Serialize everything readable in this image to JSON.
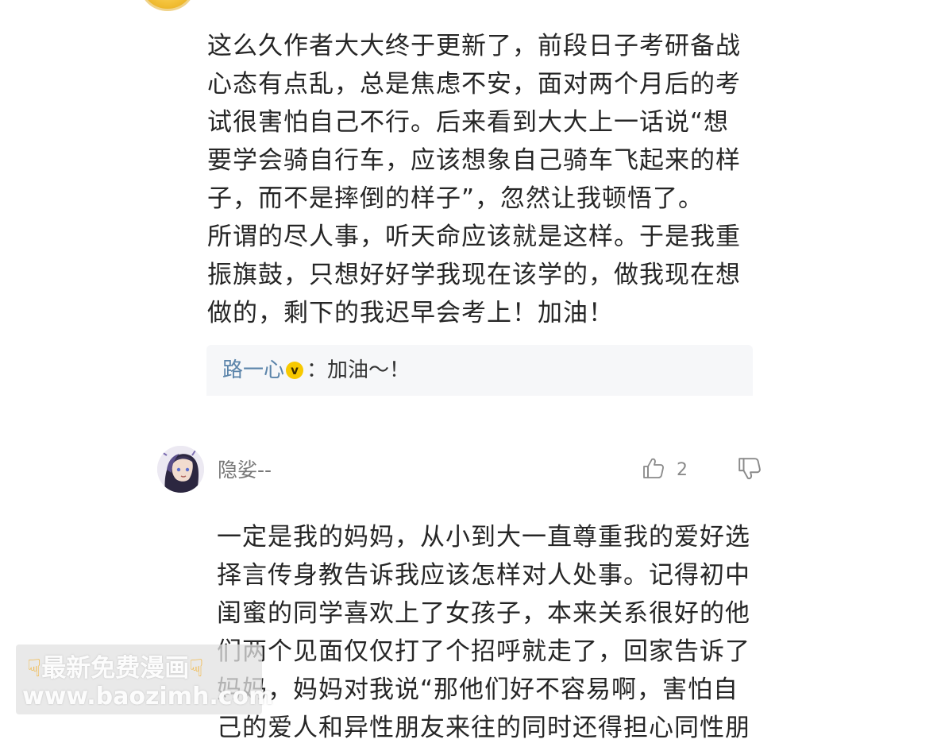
{
  "comment1": {
    "lines": [
      "这么久作者大大终于更新了，前段日子考研备战",
      "心态有点乱，总是焦虑不安，面对两个月后的考",
      "试很害怕自己不行。后来看到大大上一话说“想",
      "要学会骑自行车，应该想象自己骑车飞起来的样",
      "子，而不是摔倒的样子”，忽然让我顿悟了。",
      "所谓的尽人事，听天命应该就是这样。于是我重",
      "振旗鼓，只想好好学我现在该学的，做我现在想",
      "做的，剩下的我迟早会考上！加油！"
    ],
    "reply": {
      "author": "路一心",
      "badge": "v",
      "text": "：加油～！"
    }
  },
  "comment2": {
    "username": "隐娑--",
    "likes": "2",
    "lines": [
      "一定是我的妈妈，从小到大一直尊重我的爱好选",
      "择言传身教告诉我应该怎样对人处事。记得初中",
      "闺蜜的同学喜欢上了女孩子，本来关系很好的他",
      "们两个见面仅仅打了个招呼就走了，回家告诉了",
      "妈妈，妈妈对我说“那他们好不容易啊，害怕自",
      "己的爱人和异性朋友来往的同时还得担心同性朋"
    ]
  },
  "watermark": {
    "hand_icon": "pointing-down-hand-icon",
    "line1": "最新免费漫画",
    "line2": "www.baozimh.com"
  },
  "colors": {
    "reply_author": "#5b84aa",
    "badge": "#f7c900",
    "reply_bg": "#f6f7f9"
  }
}
